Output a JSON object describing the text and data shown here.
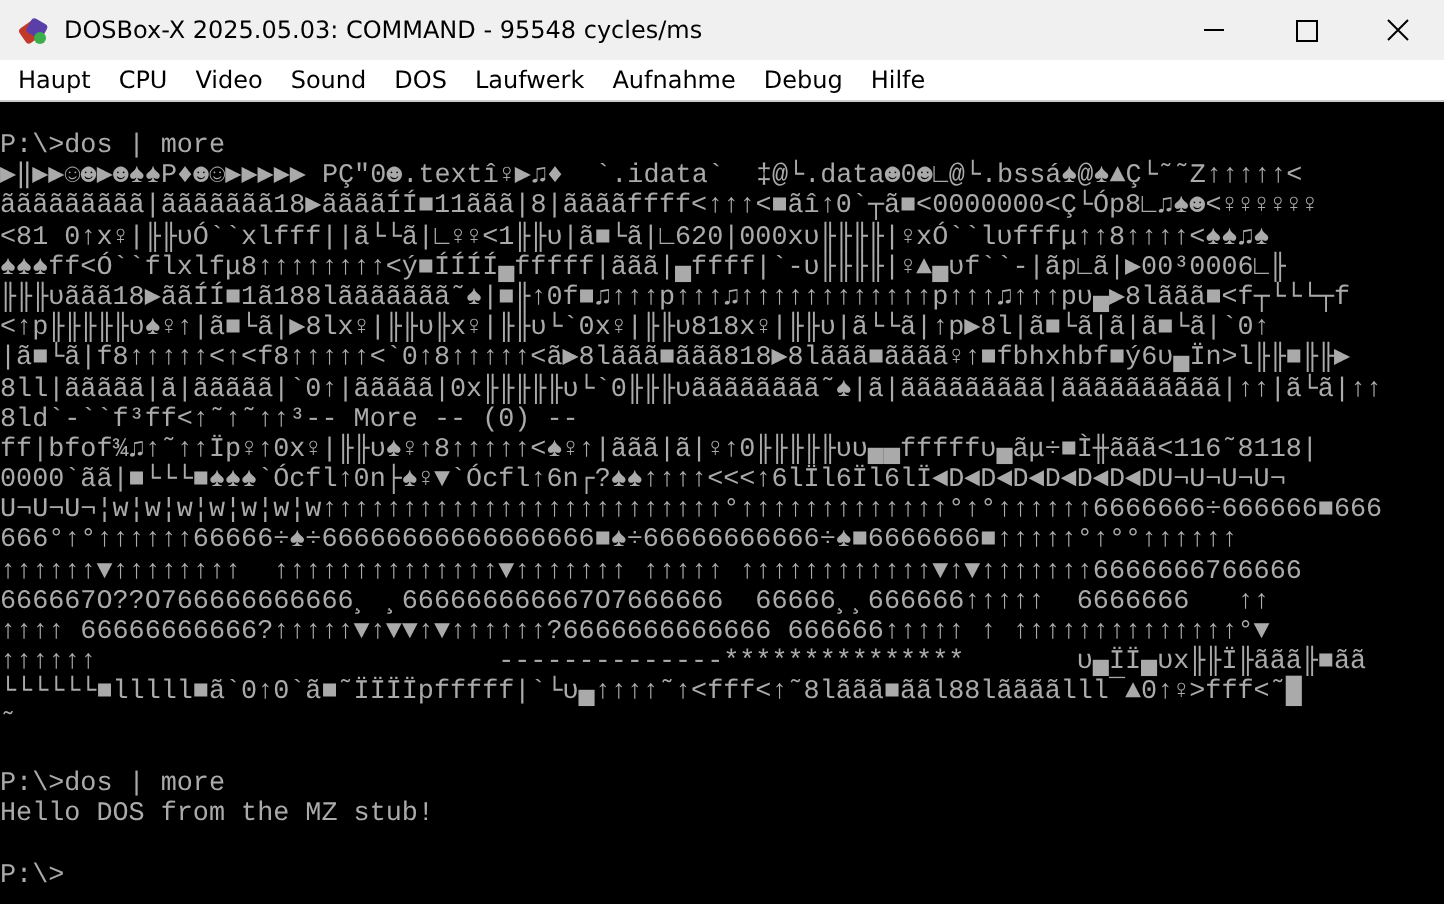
{
  "window": {
    "title": "DOSBox-X 2025.05.03: COMMAND - 95548 cycles/ms"
  },
  "menu": [
    "Haupt",
    "CPU",
    "Video",
    "Sound",
    "DOS",
    "Laufwerk",
    "Aufnahme",
    "Debug",
    "Hilfe"
  ],
  "console": {
    "lines": [
      {
        "kind": "text",
        "text": "P:\\>dos | more"
      },
      {
        "kind": "text",
        "text": "▶‖▶▶☺☻▶☻♠♠P♦☻☺▶▶▶▶▶ PÇ\"0☻.textî♀▶♫♦  `.idata`  ‡@└.data☻0☻∟@└.bssá♠@♠▲Ç└˜˜Z↑↑↑↑↑<"
      },
      {
        "kind": "text",
        "text": "ããããããããã|ããããããã18▶ããããÍÍ■11ããã|8|ããããffff<↑↑↑<■ãî↑0`┬ã■<0000000<Ç└Óp8∟♫♠☻<♀♀♀♀♀♀"
      },
      {
        "kind": "text",
        "text": "<81 0↑x♀|╟╟υÓ``xlfff||ã└└ã|∟♀♀<1╟╟υ|ã■└ã|∟620|000xυ╟╟╟╟|♀xÓ``lυfffμ↑↑8↑↑↑↑<♠♠♫♠"
      },
      {
        "kind": "text",
        "text": "♠♠♠ff<Ó``flxlfμ8↑↑↑↑↑↑↑↑<ý■ÍÍÍÍ▄fffff|ããã|▄ffff|`-υ╟╟╟╟|♀▲▄υf``-|ãp∟ã|▶00³0006∟╟"
      },
      {
        "kind": "text",
        "text": "╟╟╟υããã18▶ããÍÍ■1ã188lããããããã˜♠|■╟↑0f■♫↑↑↑p↑↑↑♫↑↑↑↑↑↑↑↑↑↑↑↑p↑↑↑♫↑↑↑pυ▄▶8lããã■<f┬└└└┬f"
      },
      {
        "kind": "text",
        "text": "<↑p╟╟╟╟╟υ♠♀↑|ã■└ã|▶8lx♀|╟╟υ╟x♀|╟╟υ└`0x♀|╟╟υ818x♀|╟╟υ|ã└└ã|↑p▶8l|ã■└ã|ã|ã■└ã|`0↑"
      },
      {
        "kind": "text",
        "text": "|ã■└ã|f8↑↑↑↑↑<↑<f8↑↑↑↑↑<`0↑8↑↑↑↑↑<ã▶8lããã■ããã818▶8lããã■ãããã♀↑■fbhxhbf■ý6υ▄Ïn>l╟╟■╟╟▶"
      },
      {
        "kind": "text",
        "text": "8ll|ããããã|ã|ããããã|`0↑|ããããã|0x╟╟╟╟╟υ└`0╟╟╟υãããããããã˜♠|ã|ããããããããã|ãããããããããã|↑↑|ã└ã|↑↑"
      },
      {
        "kind": "text",
        "text": "8ld`-``f³ff<↑˜↑˜↑↑³-- More -- (0) --"
      },
      {
        "kind": "text",
        "text": "ff|bfof¾♫↑˜↑↑Ïp♀↑0x♀|╟╟υ♠♀↑8↑↑↑↑↑<♠♀↑|ããã|ã|♀↑0╟╟╟╟╟υυ▄▄fffffυ▄ãμ÷■Ì╫ããã<116˜8118|"
      },
      {
        "kind": "text",
        "text": "0000`ãã|■└└└■♠♠♠`Ócfl↑0n├♠♀▼`Ócfl↑6n┌?♠♠↑↑↑↑<<<↑6lÏl6Ïl6lÏ◄D◄D◄D◄D◄D◄D◄DU¬U¬U¬U¬"
      },
      {
        "kind": "text",
        "text": "U¬U¬U¬¦w¦w¦w¦w¦w¦w¦w↑↑↑↑↑↑↑↑↑↑↑↑↑↑↑↑↑↑↑↑↑↑↑↑↑°↑↑↑↑↑↑↑↑↑↑↑↑↑°↑°↑↑↑↑↑↑6666666÷666666■666"
      },
      {
        "kind": "text",
        "text": "666°↑°↑↑↑↑↑↑66666÷♠÷66666666666666666■♠÷66666666666÷♠■6666666■↑↑↑↑↑°↑°°↑↑↑↑↑↑"
      },
      {
        "kind": "text",
        "text": "↑↑↑↑↑↑▼↑↑↑↑↑↑↑↑  ↑↑↑↑↑↑↑↑↑↑↑↑↑↑▼↑↑↑↑↑↑↑ ↑↑↑↑↑ ↑↑↑↑↑↑↑↑↑↑↑↑▼↑▼↑↑↑↑↑↑↑6666666766666"
      },
      {
        "kind": "text",
        "text": "666667O??O766666666666¸ ¸666666666667O7666666  66666¸¸666666↑↑↑↑↑  6666666   ↑↑"
      },
      {
        "kind": "text",
        "text": "↑↑↑↑ 66666666666?↑↑↑↑↑▼↑▼▼↑▼↑↑↑↑↑↑?6666666666666 666666↑↑↑↑↑ ↑ ↑↑↑↑↑↑↑↑↑↑↑↑↑↑°▼"
      },
      {
        "kind": "text",
        "text": "↑↑↑↑↑↑                         --------------***************       υ▄ÏÏ▄υx╟╟Ï╟ããã╟■ãã"
      },
      {
        "kind": "text",
        "text": "└└└└└└■lllll■ã`0↑0`ã■˜ÏÏÏÏpfffff|`└υ▄↑↑↑↑˜↑<fff<↑˜8lããã■ããl88lããããlll¯▲0↑♀>fff<˜█"
      },
      {
        "kind": "text",
        "text": "˜"
      },
      {
        "kind": "blank"
      },
      {
        "kind": "text",
        "text": "P:\\>dos | more"
      },
      {
        "kind": "text",
        "text": "Hello DOS from the MZ stub!"
      },
      {
        "kind": "blank"
      },
      {
        "kind": "text",
        "text": "P:\\>"
      }
    ]
  }
}
